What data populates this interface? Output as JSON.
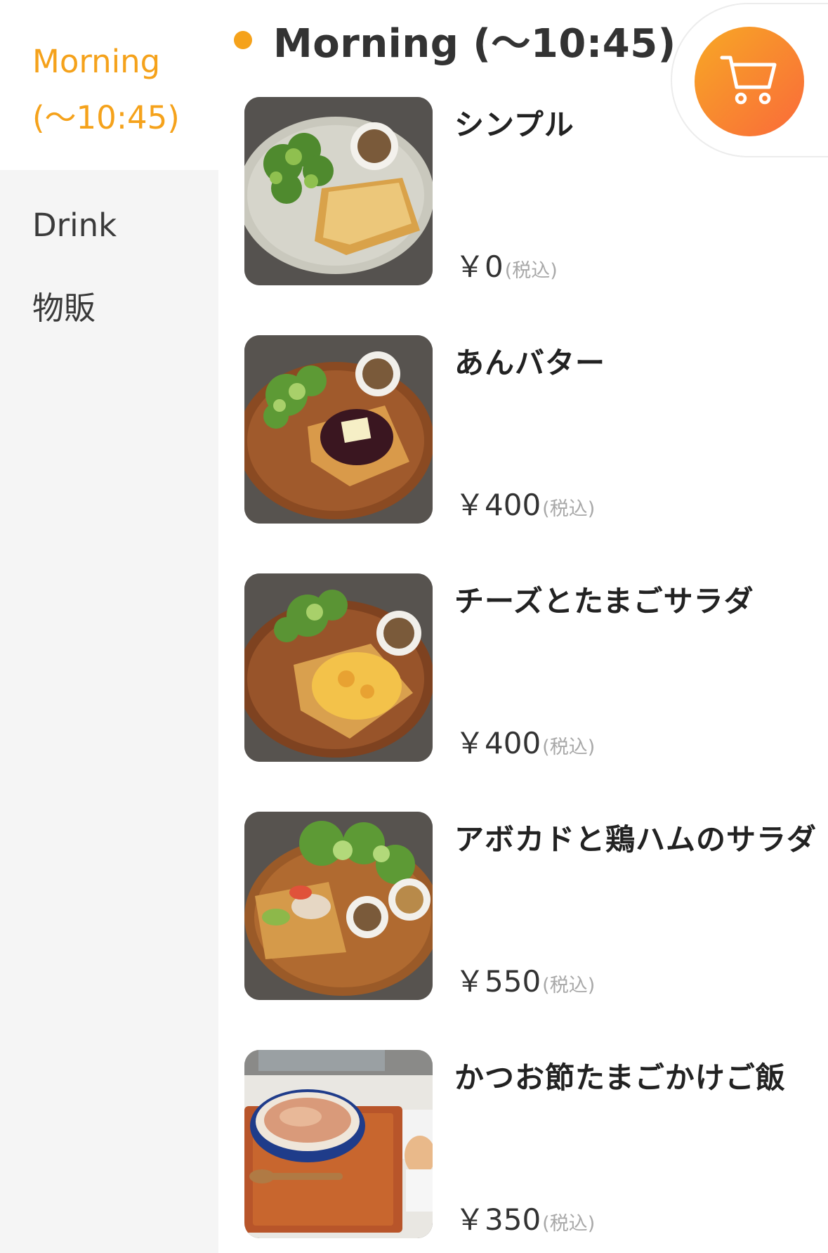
{
  "sidebar": {
    "categories": [
      {
        "label": "Morning\n(〜10:45)",
        "line1": "Morning",
        "line2": "(〜10:45)"
      },
      {
        "label": "Drink"
      },
      {
        "label": "物販"
      }
    ]
  },
  "section": {
    "title": "Morning (〜10:45)"
  },
  "items": [
    {
      "name": "シンプル",
      "price": "￥0",
      "tax": "(税込)",
      "icon": "toast-plate-photo"
    },
    {
      "name": "あんバター",
      "price": "￥400",
      "tax": "(税込)",
      "icon": "anbutter-toast-photo"
    },
    {
      "name": "チーズとたまごサラダ",
      "price": "￥400",
      "tax": "(税込)",
      "icon": "cheese-egg-toast-photo"
    },
    {
      "name": "アボカドと鶏ハムのサラダ",
      "price": "￥550",
      "tax": "(税込)",
      "icon": "avocado-chicken-toast-photo"
    },
    {
      "name": "かつお節たまごかけご飯",
      "price": "￥350",
      "tax": "(税込)",
      "icon": "egg-rice-bowl-photo"
    }
  ],
  "cart": {
    "icon": "cart-icon"
  },
  "colors": {
    "accent": "#f5a21b",
    "cart_gradient_start": "#f7a825",
    "cart_gradient_end": "#fa6a3a",
    "sidebar_bg": "#f5f5f5"
  }
}
